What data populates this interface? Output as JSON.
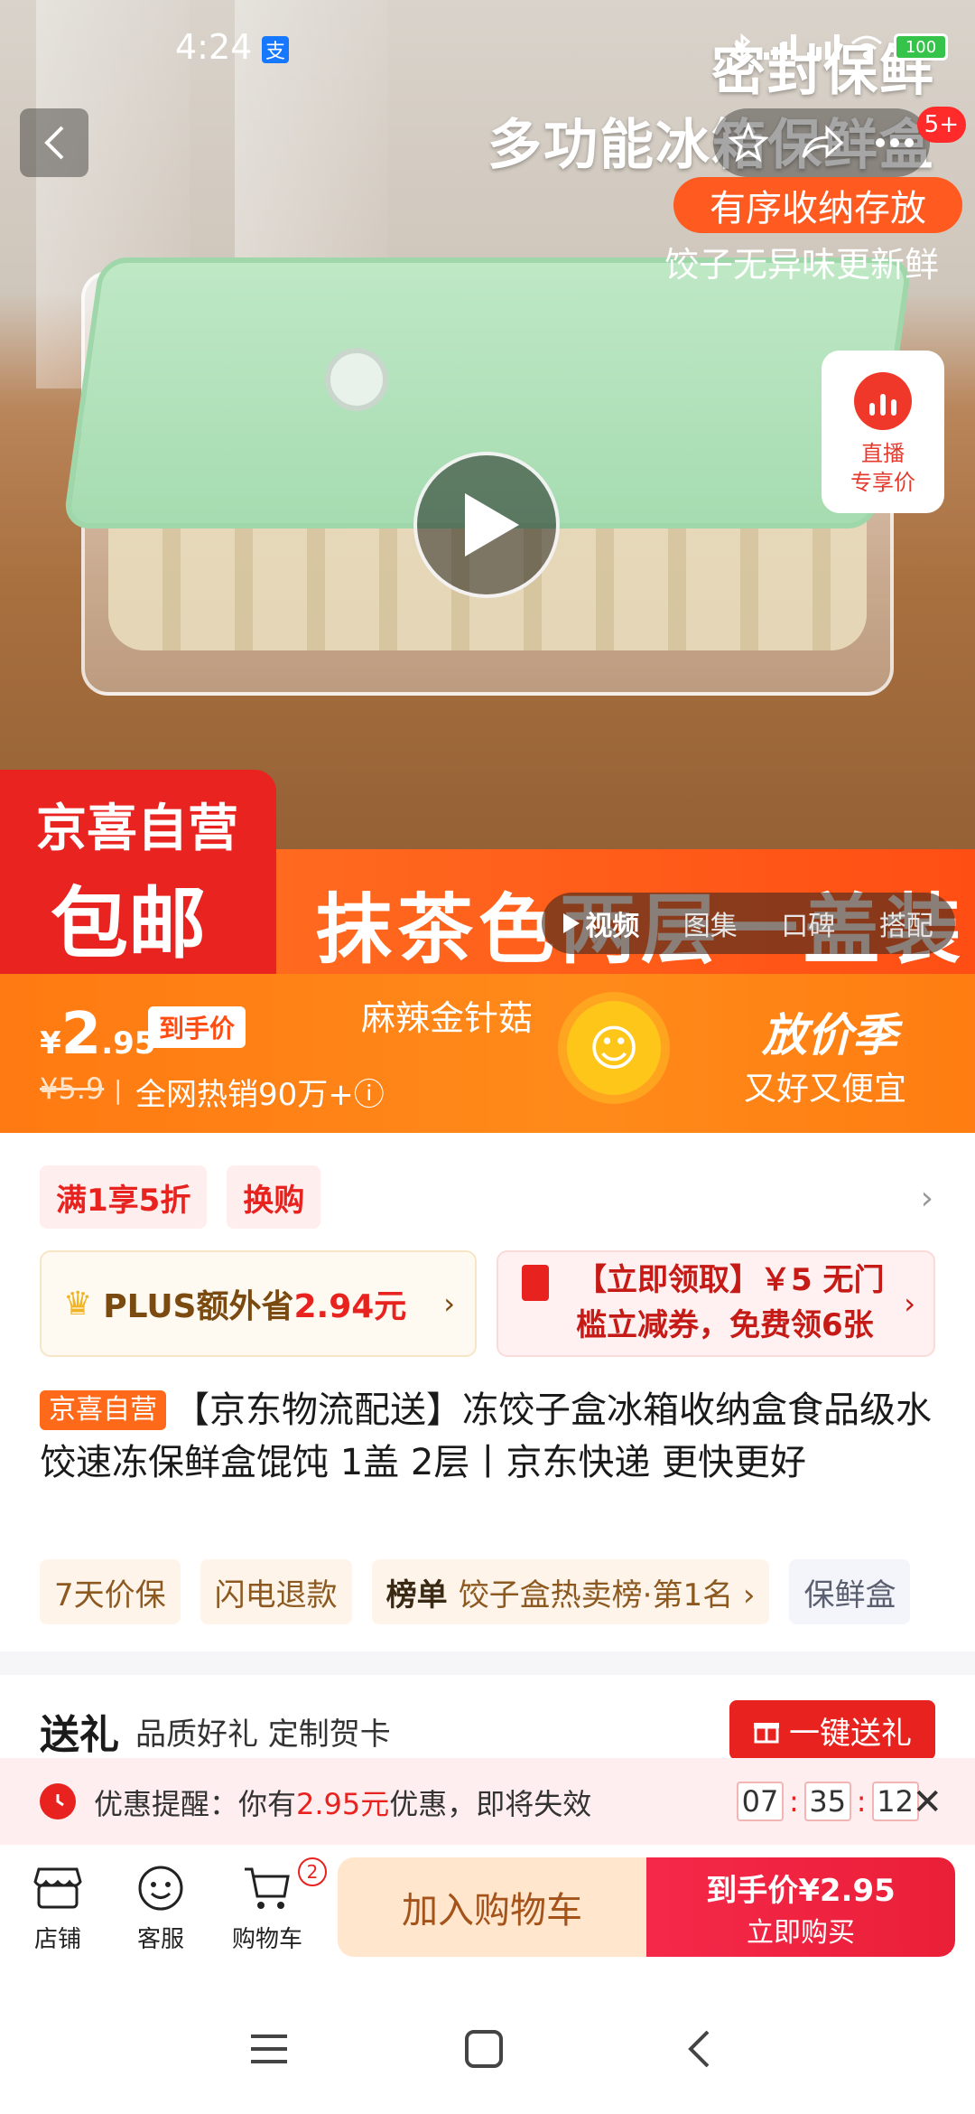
{
  "status_bar": {
    "time": "4:24",
    "alipay_icon": "支",
    "battery": "100"
  },
  "top_bar": {
    "cart_count_badge": "5+"
  },
  "hero": {
    "title_line1": "密封保鲜",
    "title_line2": "多功能冰箱保鲜盒",
    "pill_text": "有序收纳存放",
    "subtitle": "饺子无异味更新鲜",
    "live_label_line1": "直播",
    "live_label_line2": "专享价",
    "self_badge_line1": "京喜自营",
    "self_badge_line2": "包邮",
    "strip_text": "抹茶色两层一盖装",
    "media_tabs": [
      "视频",
      "图集",
      "口碑",
      "搭配"
    ]
  },
  "price_banner": {
    "currency": "¥",
    "price_int": "2",
    "price_dec": ".95",
    "price_tag": "到手价",
    "flavor": "麻辣金针菇",
    "original_price": "¥5.9",
    "separator": "|",
    "hot_sales": "全网热销90万+ⓘ",
    "season_title": "放价季",
    "season_slogan": "又好又便宜"
  },
  "promotions": {
    "tags": [
      "满1享5折",
      "换购"
    ],
    "plus_text": "PLUS额外省",
    "plus_amount": "2.94元",
    "coupon_text": "【立即领取】￥5 无门槛立减券，免费领6张"
  },
  "product": {
    "badge": "京喜自营",
    "title": "【京东物流配送】冻饺子盒冰箱收纳盒食品级水饺速冻保鲜盒馄饨 1盖 2层丨京东快递 更快更好"
  },
  "services": {
    "items": [
      "7天价保",
      "闪电退款"
    ],
    "rank_label": "榜单",
    "rank_text": "饺子盒热卖榜·第1名 ›",
    "category": "保鲜盒"
  },
  "gift": {
    "title": "送礼",
    "subtitle": "品质好礼 定制贺卡",
    "button": "一键送礼"
  },
  "reminder": {
    "prefix": "优惠提醒：你有",
    "amount": "2.95元",
    "suffix": "优惠，即将失效",
    "hours": "07",
    "minutes": "35",
    "seconds": "12"
  },
  "bottom_bar": {
    "store": "店铺",
    "service": "客服",
    "cart": "购物车",
    "cart_count": "2",
    "add_to_cart": "加入购物车",
    "buy_price_line": "到手价¥2.95",
    "buy_now": "立即购买"
  },
  "colors": {
    "accent_red": "#e8231f",
    "banner_orange": "#ff7a12",
    "lid_green": "#a6dcb1"
  }
}
